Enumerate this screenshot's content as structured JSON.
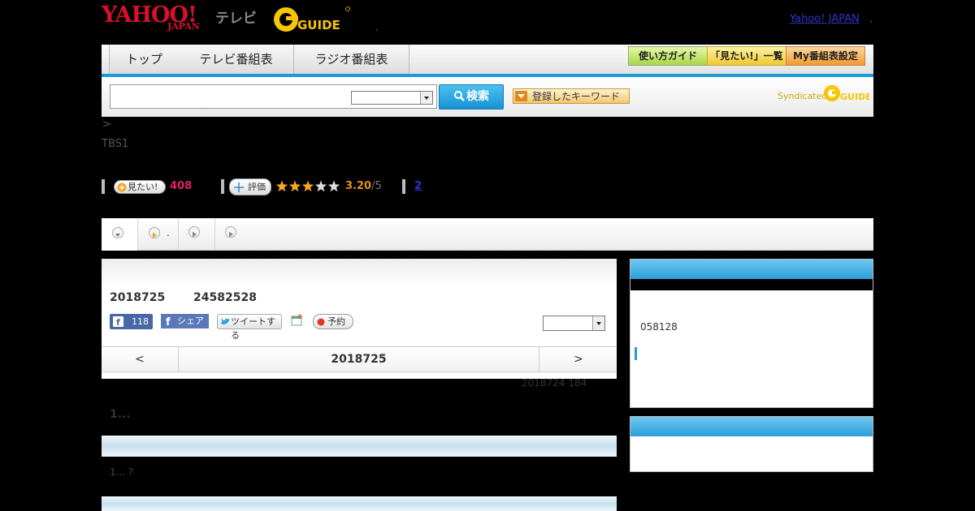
{
  "header": {
    "yahoo_logo": "YAHOO!",
    "yahoo_japan": "JAPAN",
    "tv_label": "テレビ",
    "gguide_logo": "GUIDE",
    "yahoo_link": "Yahoo! JAPAN",
    "link_sep": ","
  },
  "nav": {
    "tabs": [
      "トップ",
      "テレビ番組表",
      "ラジオ番組表"
    ],
    "buttons": [
      "使い方ガイド",
      "「見たい!」一覧",
      "My番組表設定"
    ]
  },
  "search": {
    "button": "検索",
    "keyword_button": "登録したキーワード",
    "syndicated": "Syndicated",
    "syndicated_logo": "GUIDE"
  },
  "breadcrumb": {
    "arrow": ">",
    "channel": "TBS1"
  },
  "stats": {
    "want_label": "見たい!",
    "want_count": "408",
    "rate_label": "評価",
    "rating": "3.20",
    "rating_max": "/5",
    "rating_stars": 3,
    "review_count": "2"
  },
  "tabs": {
    "second_suffix": "."
  },
  "program": {
    "date": "2018725",
    "time": "24582528",
    "like_count": "118",
    "share_label": "シェア",
    "tweet_label": "ツイートする",
    "reserve_label": "予約",
    "prev": "<",
    "next": ">",
    "nav_date": "2018725",
    "meta": "2018724  184"
  },
  "content": {
    "heading": "1...",
    "text": "1...  ?"
  },
  "sidebar": {
    "number": "058128"
  }
}
